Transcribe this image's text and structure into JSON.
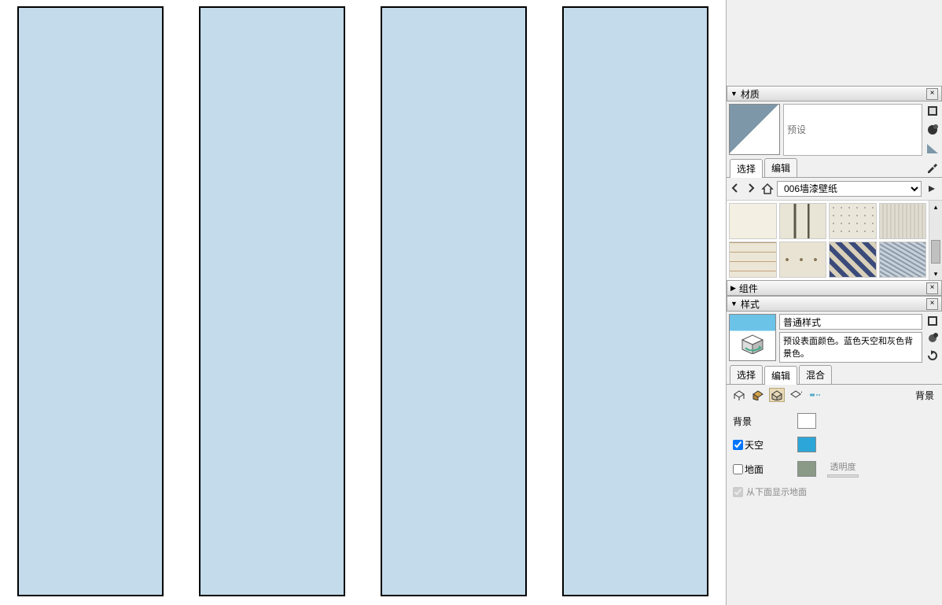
{
  "viewport": {
    "panels": [
      "",
      "",
      "",
      ""
    ],
    "fill_color": "#c3dbea"
  },
  "materials_panel": {
    "title": "材质",
    "preset_placeholder": "预设",
    "tabs": {
      "select": "选择",
      "edit": "编辑"
    },
    "library_dropdown": "006墙漆壁纸",
    "thumbs": [
      {
        "name": "mat-1"
      },
      {
        "name": "mat-2"
      },
      {
        "name": "mat-3"
      },
      {
        "name": "mat-4"
      },
      {
        "name": "mat-5"
      },
      {
        "name": "mat-6"
      },
      {
        "name": "mat-7"
      },
      {
        "name": "mat-8"
      }
    ]
  },
  "components_panel": {
    "title": "组件"
  },
  "styles_panel": {
    "title": "样式",
    "style_name": "普通样式",
    "style_desc": "预设表面颜色。蓝色天空和灰色背景色。",
    "tabs": {
      "select": "选择",
      "edit": "编辑",
      "mix": "混合"
    },
    "toolbar_label_bg": "背景",
    "bg_section": {
      "background_label": "背景",
      "background_color": "#ffffff",
      "sky_label": "天空",
      "sky_checked": true,
      "sky_color": "#2ca6d8",
      "ground_label": "地面",
      "ground_checked": false,
      "ground_color": "#8a9a86",
      "transparency_label": "透明度",
      "show_ground_below_label": "从下面显示地面",
      "show_ground_below_checked": true
    }
  }
}
